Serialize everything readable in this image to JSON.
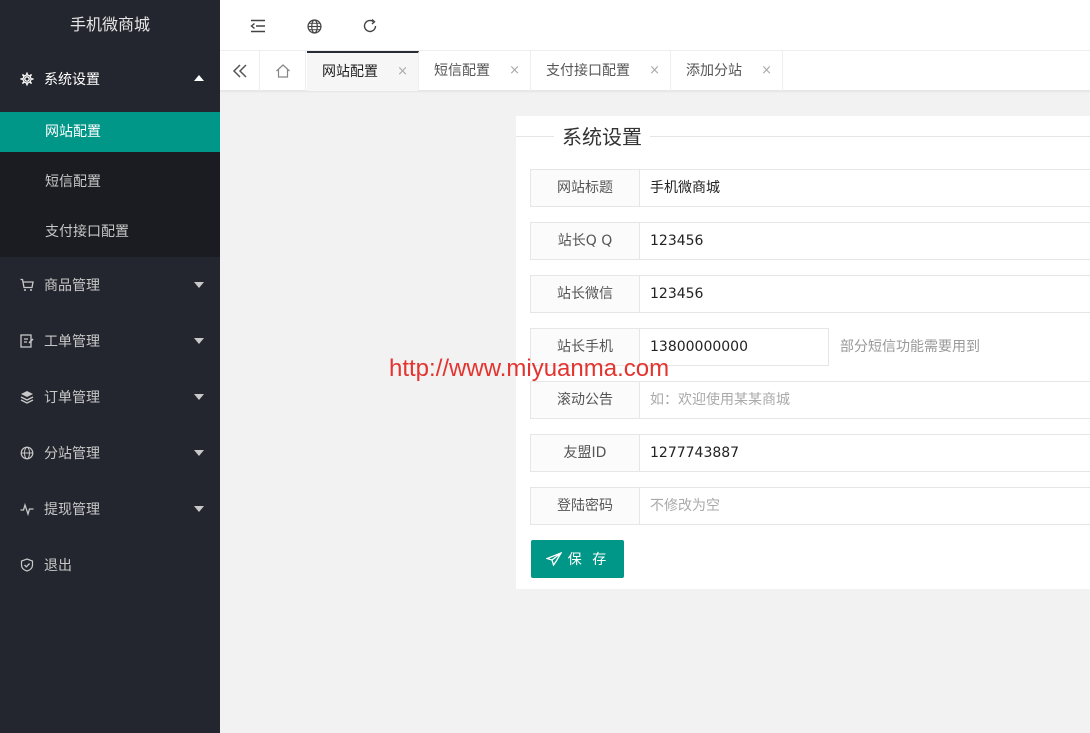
{
  "app": {
    "title": "手机微商城"
  },
  "sidebar": {
    "items": [
      {
        "label": "系统设置",
        "icon": "gear-icon",
        "open": true,
        "children": [
          {
            "label": "网站配置",
            "active": true
          },
          {
            "label": "短信配置"
          },
          {
            "label": "支付接口配置"
          }
        ]
      },
      {
        "label": "商品管理",
        "icon": "cart-icon"
      },
      {
        "label": "工单管理",
        "icon": "ticket-icon"
      },
      {
        "label": "订单管理",
        "icon": "layers-icon"
      },
      {
        "label": "分站管理",
        "icon": "globe-icon"
      },
      {
        "label": "提现管理",
        "icon": "pulse-icon"
      },
      {
        "label": "退出",
        "icon": "shield-icon"
      }
    ]
  },
  "header": {
    "icons": [
      "menu-collapse-icon",
      "globe-icon",
      "refresh-icon"
    ]
  },
  "tabs": {
    "items": [
      {
        "label": "网站配置",
        "active": true
      },
      {
        "label": "短信配置"
      },
      {
        "label": "支付接口配置"
      },
      {
        "label": "添加分站"
      }
    ],
    "close_glyph": "×"
  },
  "form": {
    "section_title": "系统设置",
    "fields": [
      {
        "label": "网站标题",
        "value": "手机微商城",
        "placeholder": ""
      },
      {
        "label": "站长Q Q",
        "value": "123456",
        "placeholder": ""
      },
      {
        "label": "站长微信",
        "value": "123456",
        "placeholder": ""
      },
      {
        "label": "站长手机",
        "value": "13800000000",
        "placeholder": "",
        "tip": "部分短信功能需要用到"
      },
      {
        "label": "滚动公告",
        "value": "",
        "placeholder": "如：欢迎使用某某商城"
      },
      {
        "label": "友盟ID",
        "value": "1277743887",
        "placeholder": ""
      },
      {
        "label": "登陆密码",
        "value": "",
        "placeholder": "不修改为空"
      }
    ],
    "save_label": "保 存"
  },
  "watermark": "http://www.miyuanma.com",
  "colors": {
    "sidebar_bg": "#23262e",
    "accent": "#009688",
    "watermark": "#e3342f"
  }
}
